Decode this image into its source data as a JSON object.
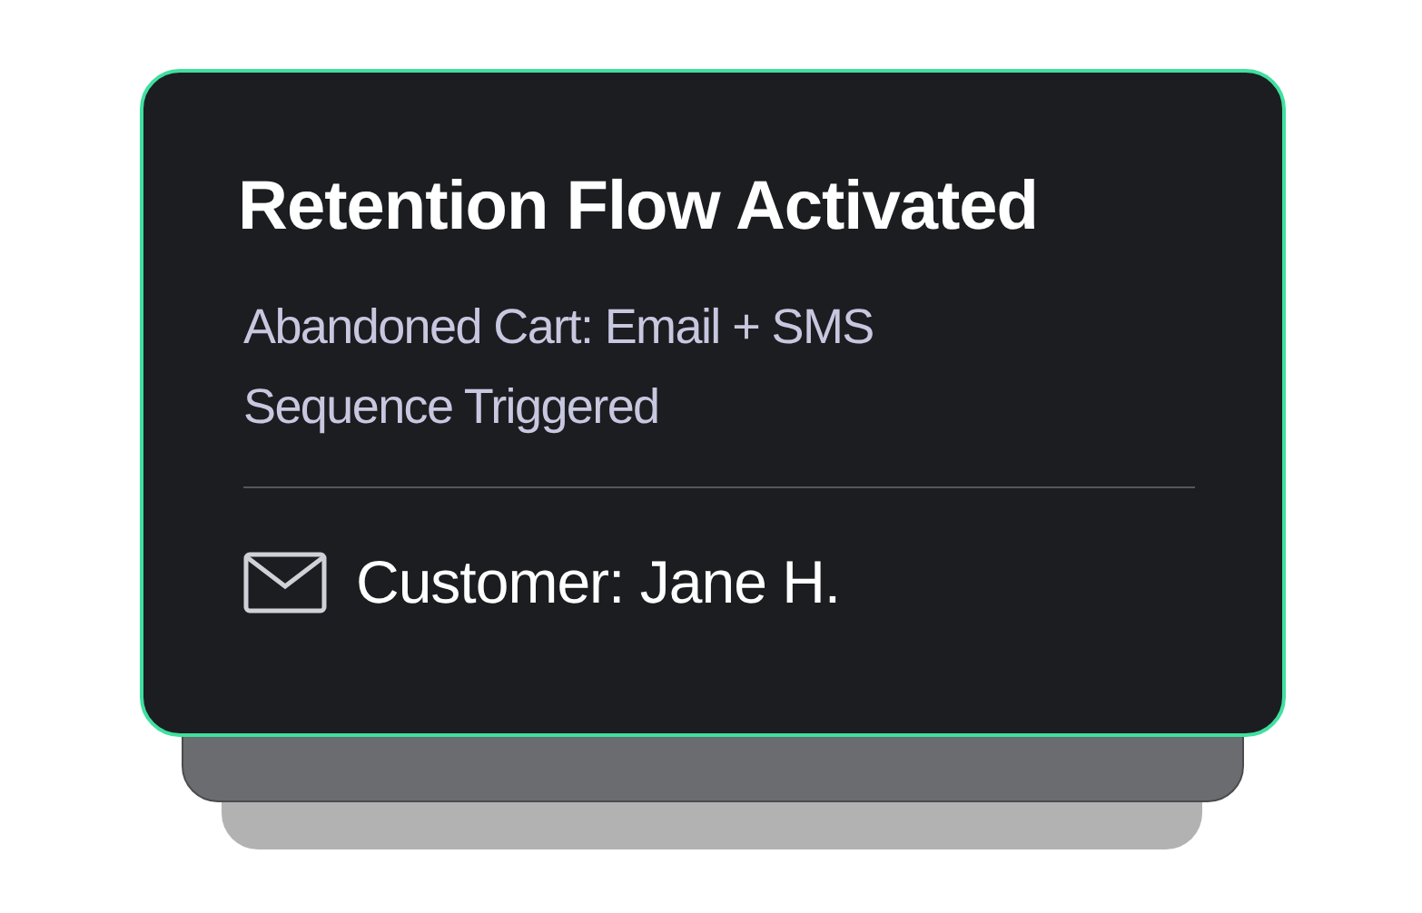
{
  "notification": {
    "title": "Retention Flow Activated",
    "message": "Abandoned Cart: Email + SMS Sequence Triggered",
    "customer": "Customer: Jane H."
  }
}
